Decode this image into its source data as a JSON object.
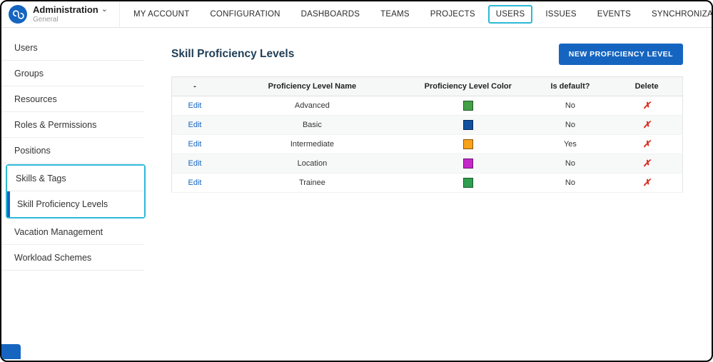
{
  "header": {
    "title": "Administration",
    "subtitle": "General",
    "nav": [
      "MY ACCOUNT",
      "CONFIGURATION",
      "DASHBOARDS",
      "TEAMS",
      "PROJECTS",
      "USERS",
      "ISSUES",
      "EVENTS",
      "SYNCHRONIZATION"
    ],
    "active_nav": "USERS"
  },
  "icons": {
    "chevron_down": "⌄",
    "help": "?",
    "delete": "✗"
  },
  "sidebar": {
    "items": [
      "Users",
      "Groups",
      "Resources",
      "Roles & Permissions",
      "Positions",
      "Skills & Tags",
      "Skill Proficiency Levels",
      "Vacation Management",
      "Workload Schemes"
    ],
    "active_item": "Skill Proficiency Levels"
  },
  "main": {
    "title": "Skill Proficiency Levels",
    "new_button_label": "NEW PROFICIENCY LEVEL",
    "table": {
      "headers": [
        "-",
        "Proficiency Level Name",
        "Proficiency Level Color",
        "Is default?",
        "Delete"
      ],
      "rows": [
        {
          "edit_label": "Edit",
          "name": "Advanced",
          "color": "#43a047",
          "is_default": "No"
        },
        {
          "edit_label": "Edit",
          "name": "Basic",
          "color": "#11519f",
          "is_default": "No"
        },
        {
          "edit_label": "Edit",
          "name": "Intermediate",
          "color": "#f9a11b",
          "is_default": "Yes"
        },
        {
          "edit_label": "Edit",
          "name": "Location",
          "color": "#c428c9",
          "is_default": "No"
        },
        {
          "edit_label": "Edit",
          "name": "Trainee",
          "color": "#2f9e4f",
          "is_default": "No"
        }
      ]
    }
  },
  "colors": {
    "accent_highlight": "#2cb9d6",
    "primary_button": "#1565c0",
    "link": "#1565c0",
    "delete_red": "#d93025"
  }
}
